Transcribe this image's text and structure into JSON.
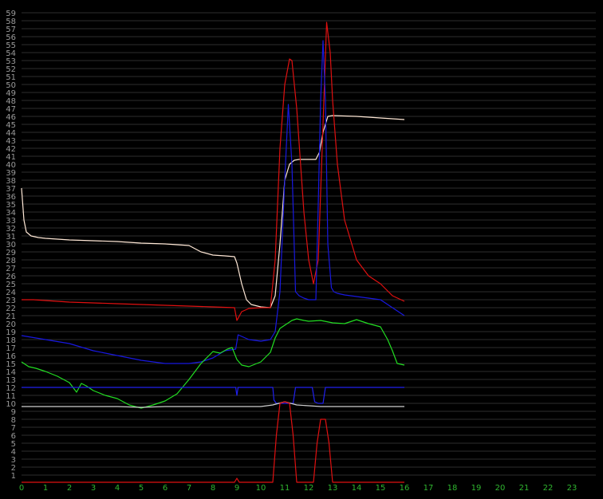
{
  "chart_data": {
    "type": "line",
    "title": "",
    "xlabel": "",
    "ylabel": "",
    "xlim": [
      0,
      24
    ],
    "ylim": [
      0,
      60
    ],
    "grid": true,
    "x_ticks": [
      "0",
      "1",
      "2",
      "3",
      "4",
      "5",
      "6",
      "7",
      "8",
      "9",
      "10",
      "11",
      "12",
      "13",
      "14",
      "15",
      "16",
      "17",
      "18",
      "19",
      "20",
      "21",
      "22",
      "23"
    ],
    "y_ticks": [
      "1",
      "2",
      "3",
      "4",
      "5",
      "6",
      "7",
      "8",
      "9",
      "10",
      "11",
      "12",
      "13",
      "14",
      "15",
      "16",
      "17",
      "18",
      "19",
      "20",
      "21",
      "22",
      "23",
      "24",
      "25",
      "26",
      "27",
      "28",
      "29",
      "30",
      "31",
      "32",
      "33",
      "34",
      "35",
      "36",
      "37",
      "38",
      "39",
      "40",
      "41",
      "42",
      "43",
      "44",
      "45",
      "46",
      "47",
      "48",
      "49",
      "50",
      "51",
      "52",
      "53",
      "54",
      "55",
      "56",
      "57",
      "58",
      "59"
    ],
    "colors": {
      "background": "#000000",
      "grid": "#2e2e2e",
      "y_tick_text": "#9a9a9a",
      "x_tick_text": "#2fb52f"
    },
    "series": [
      {
        "color": "#ffe8d6",
        "x": [
          0,
          0.1,
          0.2,
          0.4,
          0.7,
          1,
          2,
          3,
          4,
          5,
          6,
          7,
          7.5,
          8,
          8.5,
          8.9,
          9.0,
          9.2,
          9.4,
          9.6,
          10,
          10.4,
          10.6,
          10.8,
          11.0,
          11.2,
          11.4,
          11.6,
          12.0,
          12.3,
          12.45,
          12.6,
          12.8,
          13.0,
          14,
          15,
          16
        ],
        "y": [
          37,
          33,
          31.5,
          31,
          30.8,
          30.7,
          30.5,
          30.4,
          30.3,
          30.1,
          30.0,
          29.8,
          29.0,
          28.6,
          28.5,
          28.4,
          27.6,
          25.0,
          23.0,
          22.4,
          22.1,
          22.0,
          23.5,
          30.0,
          38.0,
          40.0,
          40.5,
          40.6,
          40.6,
          40.6,
          41.5,
          44.0,
          46.0,
          46.1,
          46.0,
          45.8,
          45.6
        ]
      },
      {
        "color": "#e01010",
        "x": [
          0,
          0.5,
          1,
          2,
          3,
          4,
          5,
          6,
          7,
          8,
          8.9,
          9.0,
          9.2,
          9.5,
          10,
          10.4,
          10.6,
          10.8,
          11.0,
          11.2,
          11.3,
          11.5,
          11.8,
          12.0,
          12.2,
          12.4,
          12.6,
          12.75,
          12.9,
          13.0,
          13.2,
          13.5,
          14,
          14.5,
          15,
          15.5,
          16
        ],
        "y": [
          23,
          23.0,
          22.9,
          22.7,
          22.6,
          22.5,
          22.4,
          22.3,
          22.2,
          22.1,
          22.0,
          20.4,
          21.5,
          21.9,
          22.0,
          22.0,
          28.0,
          42.0,
          50.0,
          53.2,
          53.0,
          47.0,
          34.0,
          28.0,
          25.0,
          28.0,
          45.0,
          57.8,
          54.0,
          48.0,
          40.0,
          33.0,
          28.0,
          26.0,
          25.0,
          23.5,
          22.8
        ]
      },
      {
        "color": "#1818e0",
        "x": [
          0,
          1,
          2,
          3,
          4,
          5,
          6,
          7,
          7.5,
          8,
          8.5,
          8.95,
          9.05,
          9.5,
          10,
          10.4,
          10.6,
          10.8,
          11.0,
          11.15,
          11.3,
          11.45,
          11.6,
          11.8,
          12.0,
          12.2,
          12.3,
          12.4,
          12.5,
          12.6,
          12.7,
          12.8,
          12.95,
          13.05,
          13.2,
          13.5,
          14,
          15,
          16
        ],
        "y": [
          18.5,
          18.0,
          17.5,
          16.6,
          16.0,
          15.4,
          15.0,
          15.0,
          15.2,
          15.7,
          16.6,
          16.8,
          18.6,
          18.0,
          17.8,
          18.0,
          19.0,
          24.0,
          38.0,
          47.5,
          40.0,
          24.0,
          23.5,
          23.2,
          23.0,
          23.0,
          23.0,
          35.0,
          48.0,
          55.5,
          48.0,
          30.0,
          24.5,
          24.0,
          23.8,
          23.6,
          23.4,
          23.0,
          21.0
        ]
      },
      {
        "color": "#22dd22",
        "x": [
          0,
          0.3,
          0.6,
          1,
          1.5,
          2,
          2.3,
          2.5,
          2.7,
          3,
          3.5,
          4,
          4.5,
          5,
          5.5,
          6,
          6.5,
          7,
          7.5,
          8,
          8.3,
          8.6,
          8.8,
          9.0,
          9.2,
          9.5,
          10,
          10.4,
          10.6,
          10.8,
          11.0,
          11.3,
          11.5,
          11.8,
          12,
          12.5,
          13,
          13.5,
          14,
          14.5,
          15,
          15.3,
          15.5,
          15.7,
          16
        ],
        "y": [
          15.2,
          14.6,
          14.4,
          14.0,
          13.4,
          12.6,
          11.4,
          12.5,
          12.2,
          11.6,
          11.0,
          10.6,
          9.8,
          9.4,
          9.8,
          10.3,
          11.2,
          13.0,
          15.0,
          16.5,
          16.3,
          16.8,
          17.0,
          15.5,
          14.8,
          14.6,
          15.2,
          16.4,
          18.2,
          19.4,
          19.8,
          20.4,
          20.6,
          20.4,
          20.3,
          20.4,
          20.1,
          20.0,
          20.5,
          20.0,
          19.6,
          18.0,
          16.6,
          15.0,
          14.8
        ]
      },
      {
        "color": "#2020ee",
        "x": [
          0,
          8.95,
          9.0,
          9.05,
          10.5,
          10.55,
          10.65,
          11.35,
          11.45,
          12.15,
          12.25,
          12.4,
          12.6,
          12.7,
          16
        ],
        "y": [
          12,
          12,
          11.0,
          12,
          12,
          10.4,
          10.0,
          10.0,
          12,
          12,
          10.2,
          10.0,
          10.0,
          12,
          12
        ]
      },
      {
        "color": "#cfcfcf",
        "x": [
          0,
          1,
          2,
          3,
          4,
          5,
          6,
          7,
          8,
          9,
          10,
          10.5,
          11,
          11.5,
          12,
          12.5,
          13,
          14,
          15,
          16
        ],
        "y": [
          9.6,
          9.6,
          9.6,
          9.6,
          9.6,
          9.5,
          9.6,
          9.6,
          9.6,
          9.6,
          9.6,
          9.8,
          10.2,
          9.8,
          9.7,
          9.6,
          9.6,
          9.6,
          9.6,
          9.6
        ]
      },
      {
        "color": "#e01010",
        "x": [
          0,
          8.9,
          9.0,
          9.1,
          10.5,
          10.65,
          10.8,
          11.0,
          11.2,
          11.35,
          11.5,
          12.2,
          12.35,
          12.5,
          12.7,
          12.85,
          13.0,
          16
        ],
        "y": [
          0.1,
          0.1,
          0.6,
          0.1,
          0.1,
          6.0,
          10.0,
          10.2,
          10.0,
          6.0,
          0.1,
          0.1,
          5.0,
          8.0,
          8.0,
          5.0,
          0.1,
          0.1
        ]
      }
    ]
  }
}
